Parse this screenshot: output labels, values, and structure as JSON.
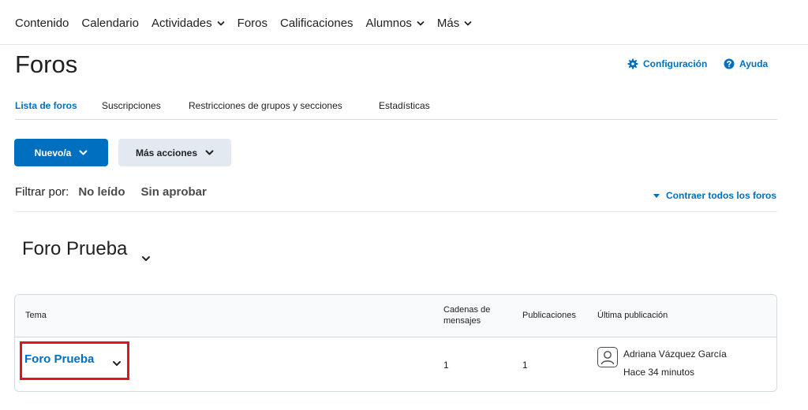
{
  "nav": {
    "items": [
      {
        "label": "Contenido",
        "dropdown": false
      },
      {
        "label": "Calendario",
        "dropdown": false
      },
      {
        "label": "Actividades",
        "dropdown": true
      },
      {
        "label": "Foros",
        "dropdown": false
      },
      {
        "label": "Calificaciones",
        "dropdown": false
      },
      {
        "label": "Alumnos",
        "dropdown": true
      },
      {
        "label": "Más",
        "dropdown": true
      }
    ]
  },
  "header": {
    "title": "Foros",
    "settings_label": "Configuración",
    "help_label": "Ayuda"
  },
  "tabs": [
    {
      "label": "Lista de foros",
      "active": true
    },
    {
      "label": "Suscripciones",
      "active": false
    },
    {
      "label": "Restricciones de grupos y secciones",
      "active": false
    },
    {
      "label": "Estadísticas",
      "active": false
    }
  ],
  "toolbar": {
    "new_label": "Nuevo/a",
    "more_actions_label": "Más acciones"
  },
  "filter": {
    "label": "Filtrar por:",
    "options": [
      "No leído",
      "Sin aprobar"
    ],
    "collapse_label": "Contraer todos los foros"
  },
  "forum": {
    "title": "Foro Prueba",
    "columns": {
      "topic": "Tema",
      "threads_line1": "Cadenas de",
      "threads_line2": "mensajes",
      "posts": "Publicaciones",
      "last_post": "Última publicación"
    },
    "rows": [
      {
        "topic": "Foro Prueba",
        "threads": "1",
        "posts": "1",
        "last_author": "Adriana Vázquez García",
        "last_time": "Hace 34 minutos"
      }
    ]
  },
  "colors": {
    "accent": "#006fbf",
    "highlight": "#e0151f",
    "text": "#202122"
  },
  "icons": {
    "settings": "gear-icon",
    "help": "help-circle-icon",
    "avatar": "user-avatar-icon"
  }
}
